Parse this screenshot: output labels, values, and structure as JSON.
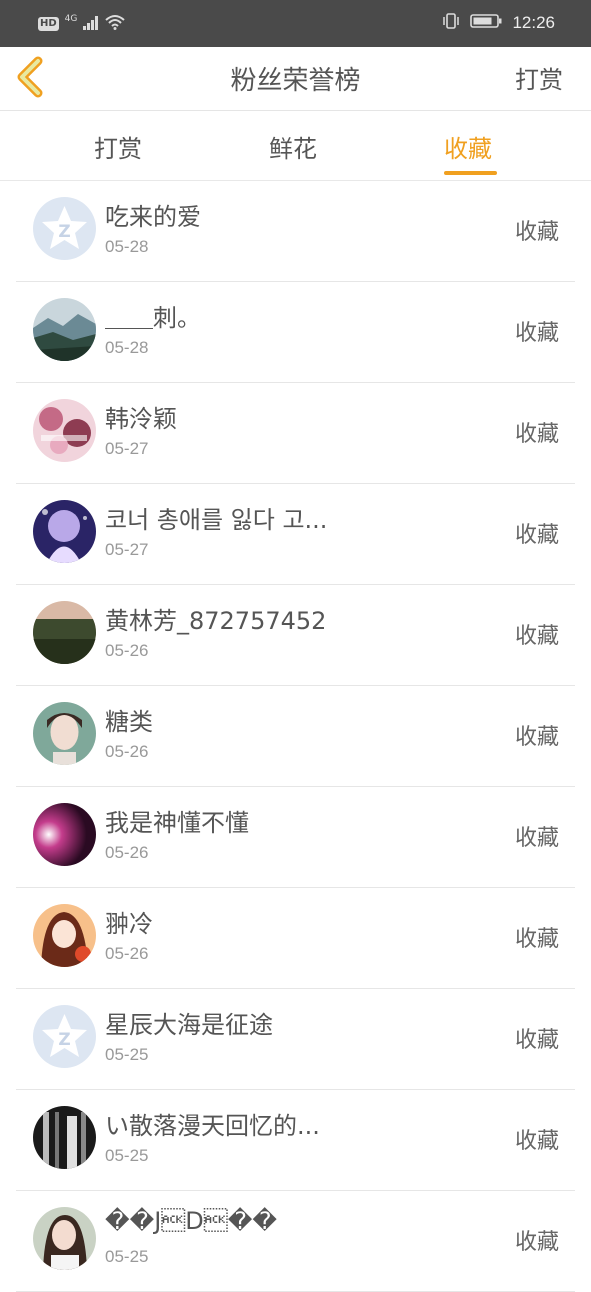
{
  "status_bar": {
    "hd_label": "HD",
    "network_label": "4G",
    "time": "12:26"
  },
  "header": {
    "title": "粉丝荣誉榜",
    "action_label": "打赏"
  },
  "tabs": [
    {
      "label": "打赏",
      "active": false
    },
    {
      "label": "鲜花",
      "active": false
    },
    {
      "label": "收藏",
      "active": true
    }
  ],
  "accent_color": "#f0a020",
  "list": [
    {
      "name": "吃来的爱",
      "date": "05-28",
      "action": "收藏",
      "avatar": "default-qq-avatar"
    },
    {
      "name": "＿＿刺。",
      "date": "05-28",
      "action": "收藏",
      "avatar": "landscape-photo-avatar"
    },
    {
      "name": "韩泠颖",
      "date": "05-27",
      "action": "收藏",
      "avatar": "pink-photo-avatar"
    },
    {
      "name": "코너 총애를 잃다 고...",
      "date": "05-27",
      "action": "收藏",
      "avatar": "anime-girl-avatar"
    },
    {
      "name": "黄林芳_872757452",
      "date": "05-26",
      "action": "收藏",
      "avatar": "forest-photo-avatar"
    },
    {
      "name": "糖类",
      "date": "05-26",
      "action": "收藏",
      "avatar": "girl-portrait-avatar"
    },
    {
      "name": "我是神懂不懂",
      "date": "05-26",
      "action": "收藏",
      "avatar": "dark-purple-avatar"
    },
    {
      "name": "翀冷",
      "date": "05-26",
      "action": "收藏",
      "avatar": "anime-red-avatar"
    },
    {
      "name": "星辰大海是征途",
      "date": "05-25",
      "action": "收藏",
      "avatar": "default-qq-avatar"
    },
    {
      "name": "い散落漫天回忆的...",
      "date": "05-25",
      "action": "收藏",
      "avatar": "bw-photo-avatar"
    },
    {
      "name": "��J\u0006D\u0006��",
      "date": "05-25",
      "action": "收藏",
      "avatar": "woman-photo-avatar"
    }
  ]
}
